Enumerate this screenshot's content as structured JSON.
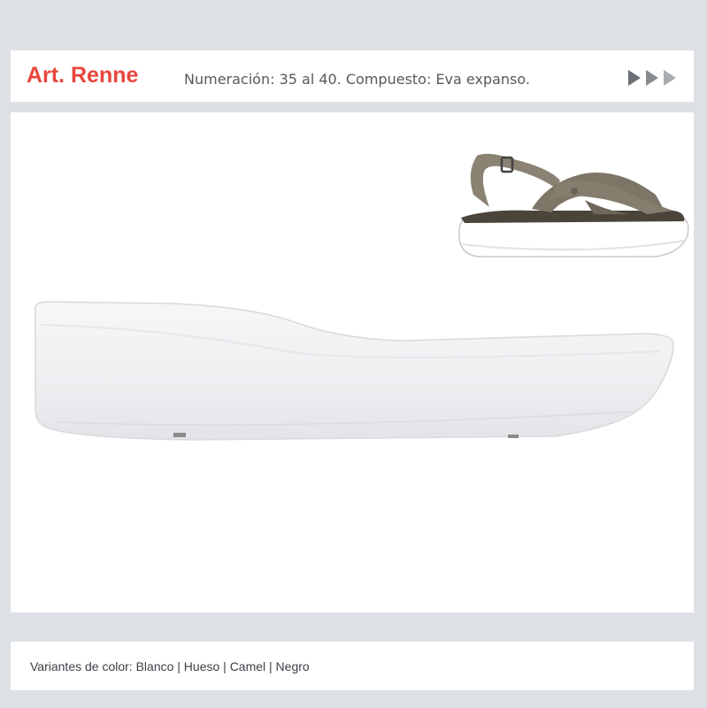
{
  "header": {
    "title": "Art. Renne",
    "spec": "Numeración: 35 al 40. Compuesto: Eva expanso.",
    "nav_icons": [
      "play-arrow-icon",
      "play-arrow-icon",
      "play-arrow-icon"
    ]
  },
  "product": {
    "sole_color": "#f4f4f6",
    "sandal_upper_color": "#7d7566"
  },
  "footer": {
    "variants": "Variantes de color: Blanco | Hueso | Camel | Negro"
  }
}
